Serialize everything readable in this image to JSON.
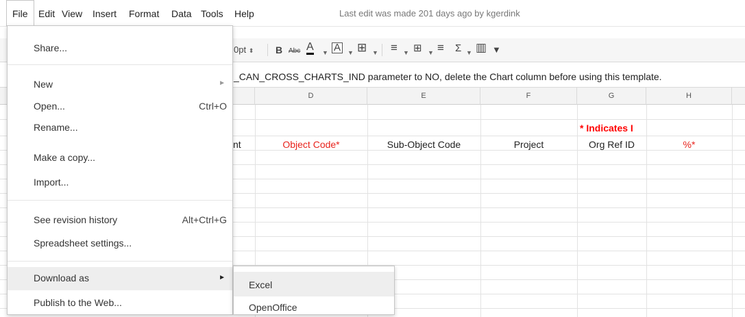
{
  "menubar": {
    "items": [
      {
        "label": "File"
      },
      {
        "label": "Edit"
      },
      {
        "label": "View"
      },
      {
        "label": "Insert"
      },
      {
        "label": "Format"
      },
      {
        "label": "Data"
      },
      {
        "label": "Tools"
      },
      {
        "label": "Help"
      }
    ],
    "last_edit": "Last edit was made 201 days ago by kgerdink"
  },
  "toolbar": {
    "font_size": "0pt",
    "bold": "B",
    "strikethrough": "Abc",
    "text_color": "A",
    "fill_color": "A",
    "borders": "⊞",
    "align": "≡",
    "merge": "⊞",
    "wrap": "≡",
    "functions": "Σ",
    "chart": "▥",
    "filter": "▼"
  },
  "notice": "_CAN_CROSS_CHARTS_IND parameter to NO, delete the Chart column before using this template.",
  "grid": {
    "columns": [
      "D",
      "E",
      "F",
      "G",
      "H"
    ],
    "partial_header_left": "nt",
    "indicator": "* Indicates I",
    "headers": [
      "Object Code*",
      "Sub-Object Code",
      "Project",
      "Org Ref ID",
      "%*"
    ]
  },
  "file_menu": {
    "items": [
      {
        "label": "Share..."
      },
      {
        "label": "New",
        "submenu": true
      },
      {
        "label": "Open...",
        "shortcut": "Ctrl+O"
      },
      {
        "label": "Rename..."
      },
      {
        "label": "Make a copy..."
      },
      {
        "label": "Import..."
      },
      {
        "label": "See revision history",
        "shortcut": "Alt+Ctrl+G"
      },
      {
        "label": "Spreadsheet settings..."
      },
      {
        "label": "Download as",
        "submenu": true
      },
      {
        "label": "Publish to the Web..."
      }
    ]
  },
  "download_submenu": {
    "items": [
      {
        "label": "Excel"
      },
      {
        "label": "OpenOffice"
      }
    ]
  },
  "colors": {
    "required_red": "#e8231c",
    "indicator_red": "#ff0000"
  }
}
